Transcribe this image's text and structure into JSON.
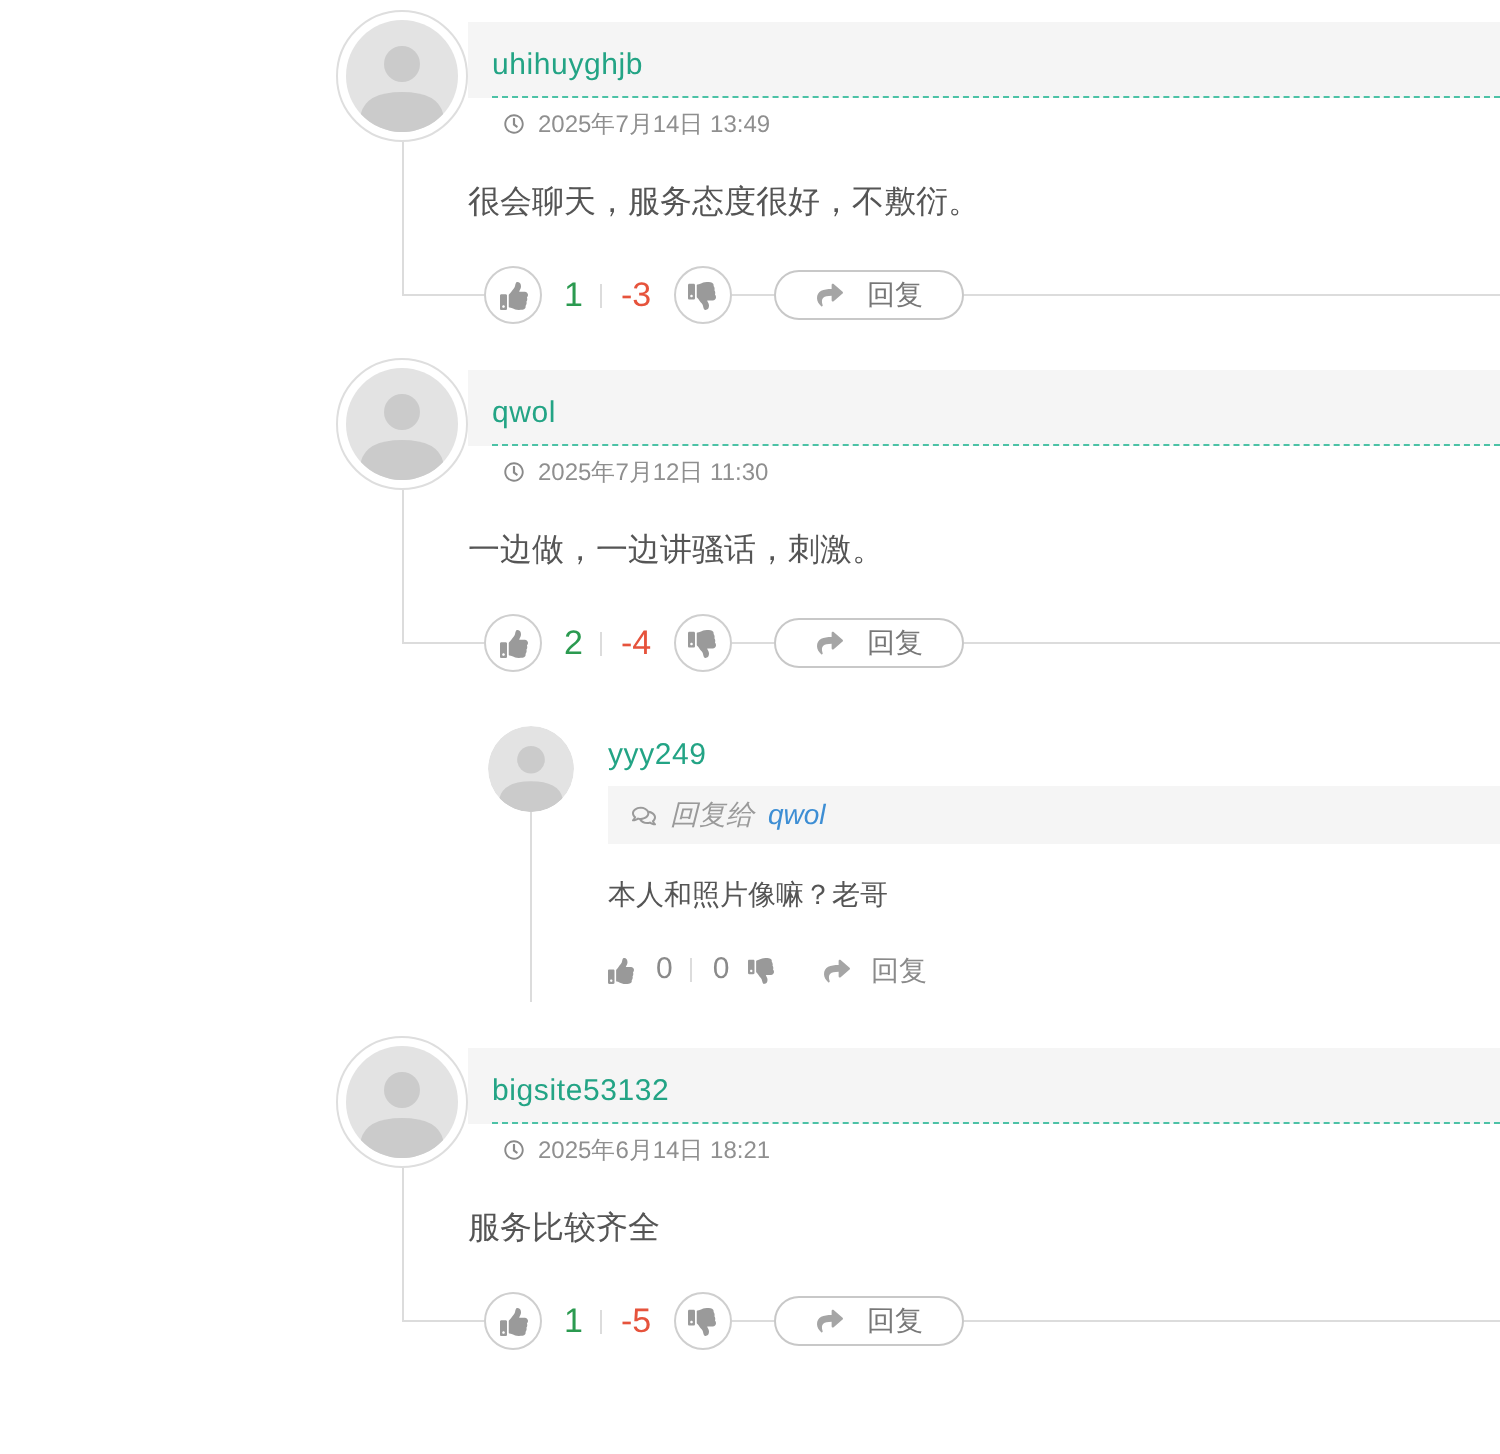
{
  "comments": [
    {
      "author": "uhihuyghjb",
      "date": "2025年7月14日 13:49",
      "text": "很会聊天，服务态度很好，不敷衍。",
      "likes": "1",
      "dislikes": "-3",
      "reply_label": "回复"
    },
    {
      "author": "qwol",
      "date": "2025年7月12日 11:30",
      "text": "一边做，一边讲骚话，刺激。",
      "likes": "2",
      "dislikes": "-4",
      "reply_label": "回复",
      "replies": [
        {
          "author": "yyy249",
          "reply_to_label": "回复给",
          "reply_to": "qwol",
          "text": "本人和照片像嘛？老哥",
          "likes": "0",
          "dislikes": "0",
          "reply_label": "回复"
        }
      ]
    },
    {
      "author": "bigsite53132",
      "date": "2025年6月14日 18:21",
      "text": "服务比较齐全",
      "likes": "1",
      "dislikes": "-5",
      "reply_label": "回复"
    }
  ]
}
